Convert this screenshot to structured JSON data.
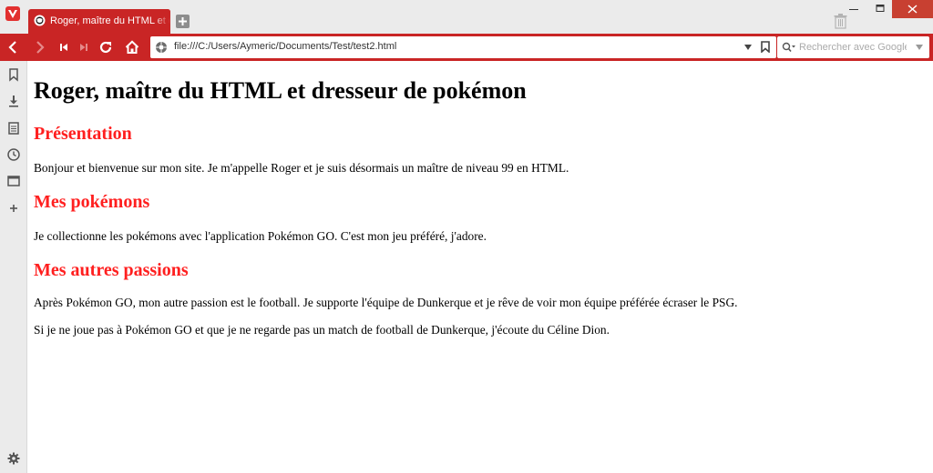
{
  "browser": {
    "tab": {
      "title": "Roger, maître du HTML et dresseur de pokémon"
    },
    "address_bar": {
      "url": "file:///C:/Users/Aymeric/Documents/Test/test2.html"
    },
    "search": {
      "placeholder": "Rechercher avec Google"
    },
    "icons": {
      "app": "vivaldi-logo-icon",
      "new_tab": "plus-icon",
      "trash": "trash-icon",
      "back": "arrow-left-icon",
      "forward": "arrow-right-icon",
      "rewind": "skip-back-icon",
      "fast_forward": "skip-forward-icon",
      "reload": "reload-icon",
      "home": "home-icon",
      "site_info": "globe-icon",
      "bookmark": "bookmark-icon",
      "search_engine": "search-icon"
    },
    "sidepanel_icons": [
      "bookmarks-icon",
      "downloads-icon",
      "notes-icon",
      "history-icon",
      "window-icon",
      "add-panel-icon",
      "settings-icon"
    ],
    "colors": {
      "accent": "#c92525",
      "heading_red": "#ff1f1f",
      "chrome_bg": "#ebebeb"
    }
  },
  "page": {
    "title": "Roger, maître du HTML et dresseur de pokémon",
    "sections": [
      {
        "heading": "Présentation",
        "paragraphs": [
          "Bonjour et bienvenue sur mon site. Je m'appelle Roger et je suis désormais un maître de niveau 99 en HTML."
        ]
      },
      {
        "heading": "Mes pokémons",
        "paragraphs": [
          "Je collectionne les pokémons avec l'application Pokémon GO. C'est mon jeu préféré, j'adore."
        ]
      },
      {
        "heading": "Mes autres passions",
        "paragraphs": [
          "Après Pokémon GO, mon autre passion est le football. Je supporte l'équipe de Dunkerque et je rêve de voir mon équipe préférée écraser le PSG.",
          "Si je ne joue pas à Pokémon GO et que je ne regarde pas un match de football de Dunkerque, j'écoute du Céline Dion."
        ]
      }
    ]
  }
}
